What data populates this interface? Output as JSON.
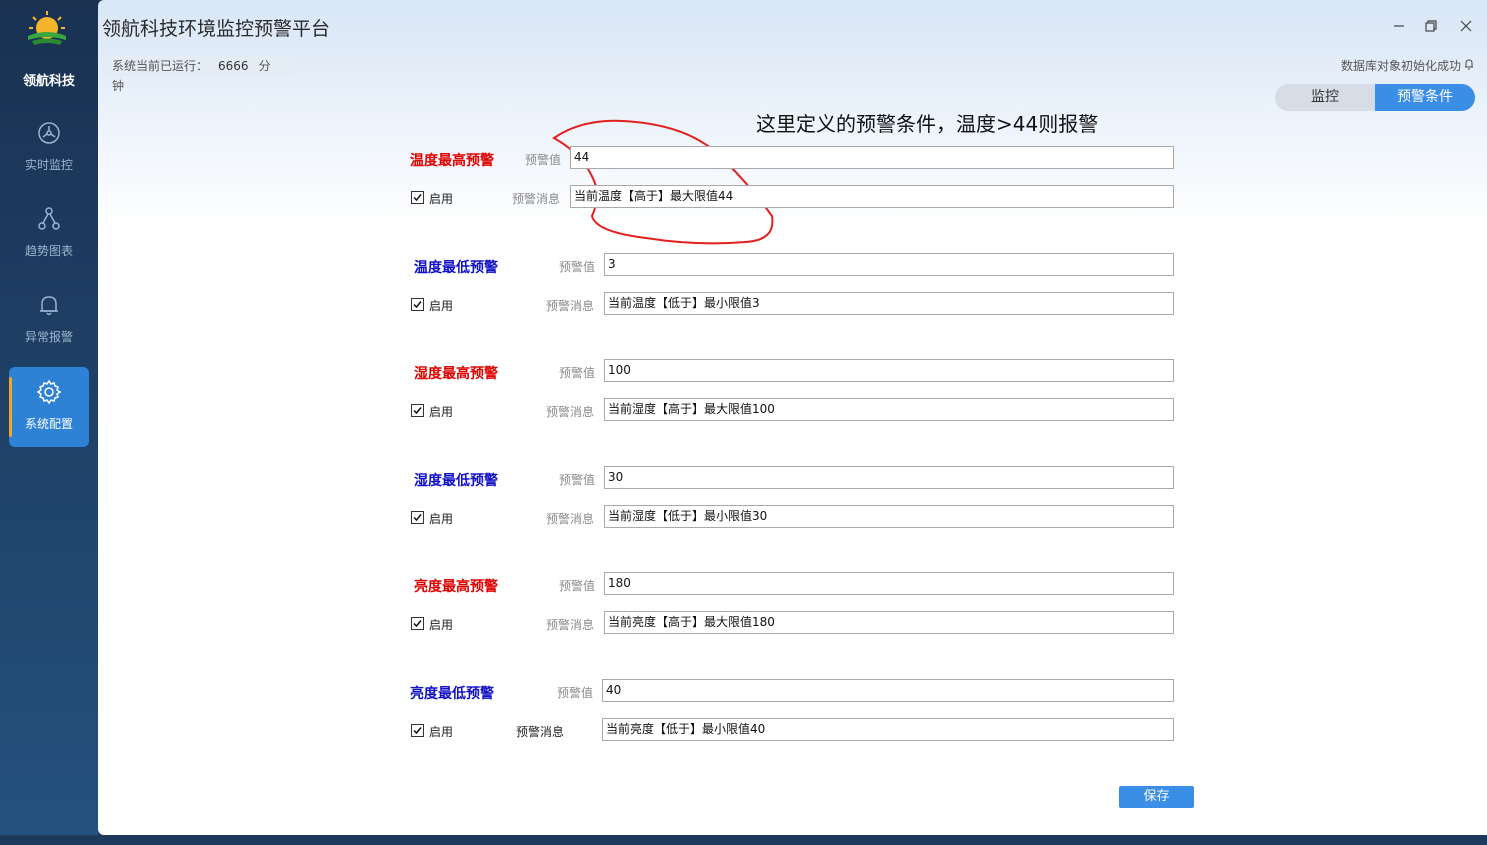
{
  "sidebar": {
    "brand": "领航科技",
    "items": [
      {
        "label": "实时监控",
        "icon": "dashboard-icon",
        "active": false
      },
      {
        "label": "趋势图表",
        "icon": "network-icon",
        "active": false
      },
      {
        "label": "异常报警",
        "icon": "bell-icon",
        "active": false
      },
      {
        "label": "系统配置",
        "icon": "gear-icon",
        "active": true
      }
    ]
  },
  "window": {
    "title": "领航科技环境监控预警平台",
    "controls": [
      "minimize",
      "restore",
      "close"
    ]
  },
  "status": {
    "uptime_label": "系统当前已运行：",
    "uptime_value": "6666",
    "uptime_unit": "分钟",
    "db_message": "数据库对象初始化成功"
  },
  "tabs": [
    {
      "label": "监控",
      "active": false
    },
    {
      "label": "预警条件",
      "active": true
    }
  ],
  "annotation": "这里定义的预警条件，温度>44则报警",
  "field_labels": {
    "value": "预警值",
    "message": "预警消息",
    "enable": "启用"
  },
  "groups": [
    {
      "title": "温度最高预警",
      "color": "red",
      "value": "44",
      "message": "当前温度【高于】最大限值44",
      "enabled": true
    },
    {
      "title": "温度最低预警",
      "color": "blue",
      "value": "3",
      "message": "当前温度【低于】最小限值3",
      "enabled": true
    },
    {
      "title": "湿度最高预警",
      "color": "red",
      "value": "100",
      "message": "当前湿度【高于】最大限值100",
      "enabled": true
    },
    {
      "title": "湿度最低预警",
      "color": "blue",
      "value": "30",
      "message": "当前湿度【低于】最小限值30",
      "enabled": true
    },
    {
      "title": "亮度最高预警",
      "color": "red",
      "value": "180",
      "message": "当前亮度【高于】最大限值180",
      "enabled": true
    },
    {
      "title": "亮度最低预警",
      "color": "blue",
      "value": "40",
      "message": "当前亮度【低于】最小限值40",
      "enabled": true
    }
  ],
  "save_label": "保存",
  "colors": {
    "accent": "#3a8ee6",
    "sidebar": "#1a3152",
    "warn_high": "#e00000",
    "warn_low": "#1010c8"
  }
}
